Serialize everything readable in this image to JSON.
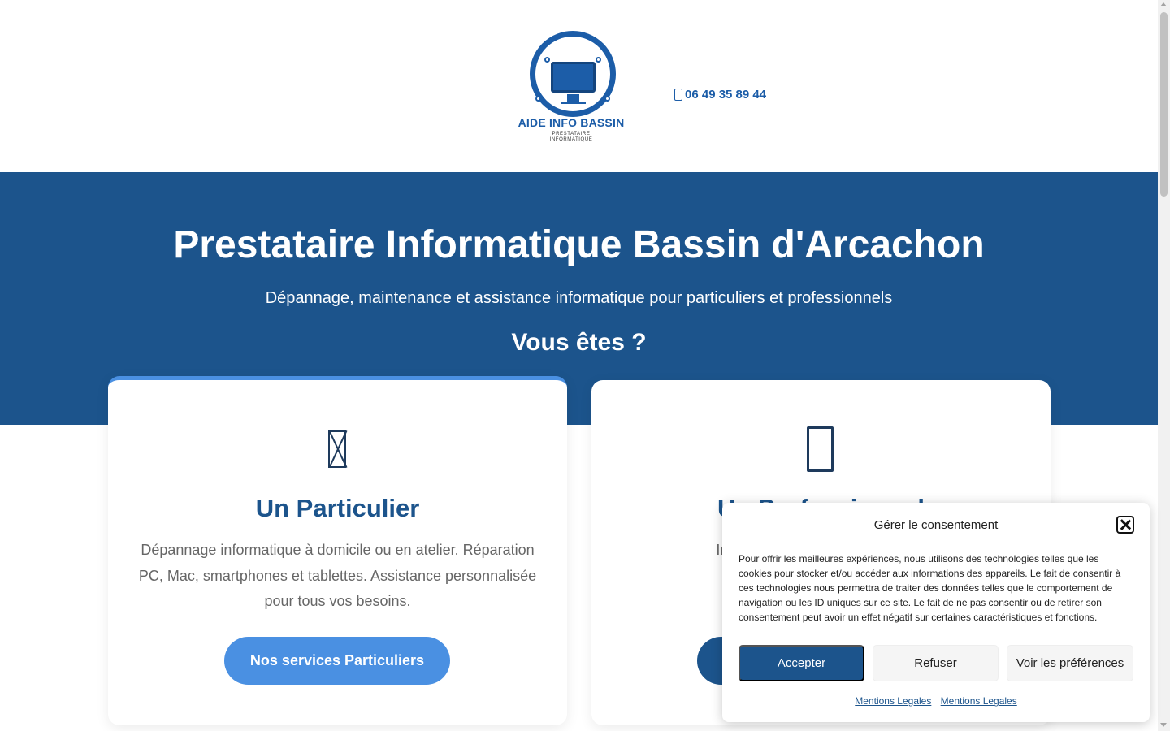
{
  "header": {
    "logo_title": "AIDE INFO BASSIN",
    "logo_subtitle_line1": "PRESTATAIRE",
    "logo_subtitle_line2": "INFORMATIQUE",
    "phone": "06 49 35 89 44",
    "phone_icon": "phone-icon"
  },
  "hero": {
    "title": "Prestataire Informatique Bassin d'Arcachon",
    "subtitle": "Dépannage, maintenance et assistance informatique pour particuliers et professionnels",
    "question": "Vous êtes ?",
    "background_color": "#1c548c"
  },
  "cards": [
    {
      "icon": "house-icon",
      "title": "Un Particulier",
      "text": "Dépannage informatique à domicile ou en atelier. Réparation PC, Mac, smartphones et tablettes. Assistance personnalisée pour tous vos besoins.",
      "button_label": "Nos services Particuliers",
      "accent_color": "#4a90e2"
    },
    {
      "icon": "briefcase-icon",
      "title": "Un Professionnel",
      "text_visible": "Infogérance ... adaptées ... main",
      "button_label": "",
      "accent_color": "#1c548c"
    }
  ],
  "consent": {
    "title": "Gérer le consentement",
    "text": "Pour offrir les meilleures expériences, nous utilisons des technologies telles que les cookies pour stocker et/ou accéder aux informations des appareils. Le fait de consentir à ces technologies nous permettra de traiter des données telles que le comportement de navigation ou les ID uniques sur ce site. Le fait de ne pas consentir ou de retirer son consentement peut avoir un effet négatif sur certaines caractéristiques et fonctions.",
    "accept_label": "Accepter",
    "refuse_label": "Refuser",
    "preferences_label": "Voir les préférences",
    "link1": "Mentions Legales",
    "link2": "Mentions Legales"
  }
}
